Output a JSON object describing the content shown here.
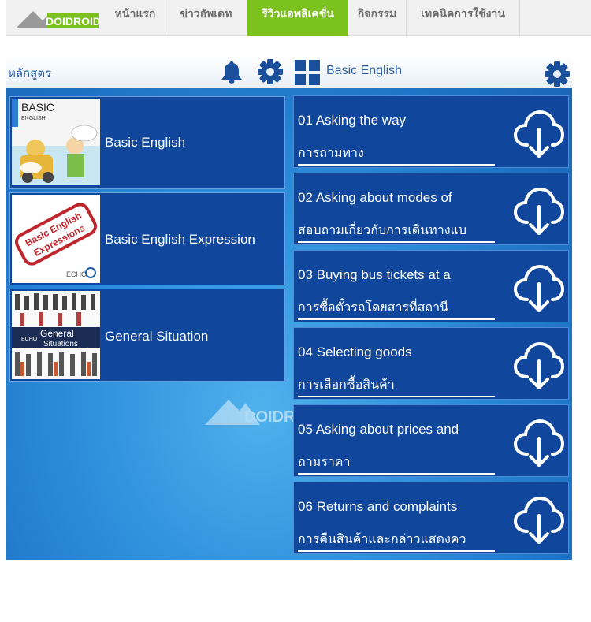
{
  "site_nav": {
    "logo_text": "DOIDROID",
    "items": [
      {
        "label": "หน้าแรก"
      },
      {
        "label": "ข่าวอัพเดท"
      },
      {
        "label": "รีวิวแอพลิเคชั่น"
      },
      {
        "label": "กิจกรรม"
      },
      {
        "label": "เทคนิคการใช้งาน"
      }
    ],
    "active_index": 2,
    "active_color": "#7cc21f"
  },
  "app": {
    "left_header": {
      "title": "หลักสูตร",
      "icons": [
        "bell-icon",
        "gear-icon"
      ]
    },
    "right_header": {
      "title": "Basic English",
      "icons": [
        "grid-icon",
        "gear-icon"
      ]
    },
    "courses": [
      {
        "name": "Basic English",
        "thumb_text": [
          "BASIC",
          "ENGLISH"
        ]
      },
      {
        "name": "Basic English Expression",
        "thumb_text": [
          "Basic English",
          "Expressions",
          "ECHO"
        ]
      },
      {
        "name": "General Situation",
        "thumb_text": [
          "General",
          "Situations",
          "ECHO"
        ]
      }
    ],
    "lessons": [
      {
        "title": "01 Asking the way",
        "subtitle": "การถามทาง"
      },
      {
        "title": "02 Asking about modes of",
        "subtitle": "สอบถามเกี่ยวกับการเดินทางแบ"
      },
      {
        "title": "03 Buying bus tickets at a",
        "subtitle": "การซื้อตั๋วรถโดยสารที่สถานี"
      },
      {
        "title": "04 Selecting goods",
        "subtitle": "การเลือกซื้อสินค้า"
      },
      {
        "title": "05 Asking about prices and",
        "subtitle": "ถามราคา"
      },
      {
        "title": "06 Returns and complaints",
        "subtitle": "การคืนสินค้าและกล่าวแสดงคว"
      }
    ],
    "lesson_icon": "cloud-download-icon",
    "watermark_text": "DOIDROID",
    "colors": {
      "tile": "#10479c",
      "header_text": "#2a5fa9",
      "background": "#2e8fdc"
    }
  }
}
